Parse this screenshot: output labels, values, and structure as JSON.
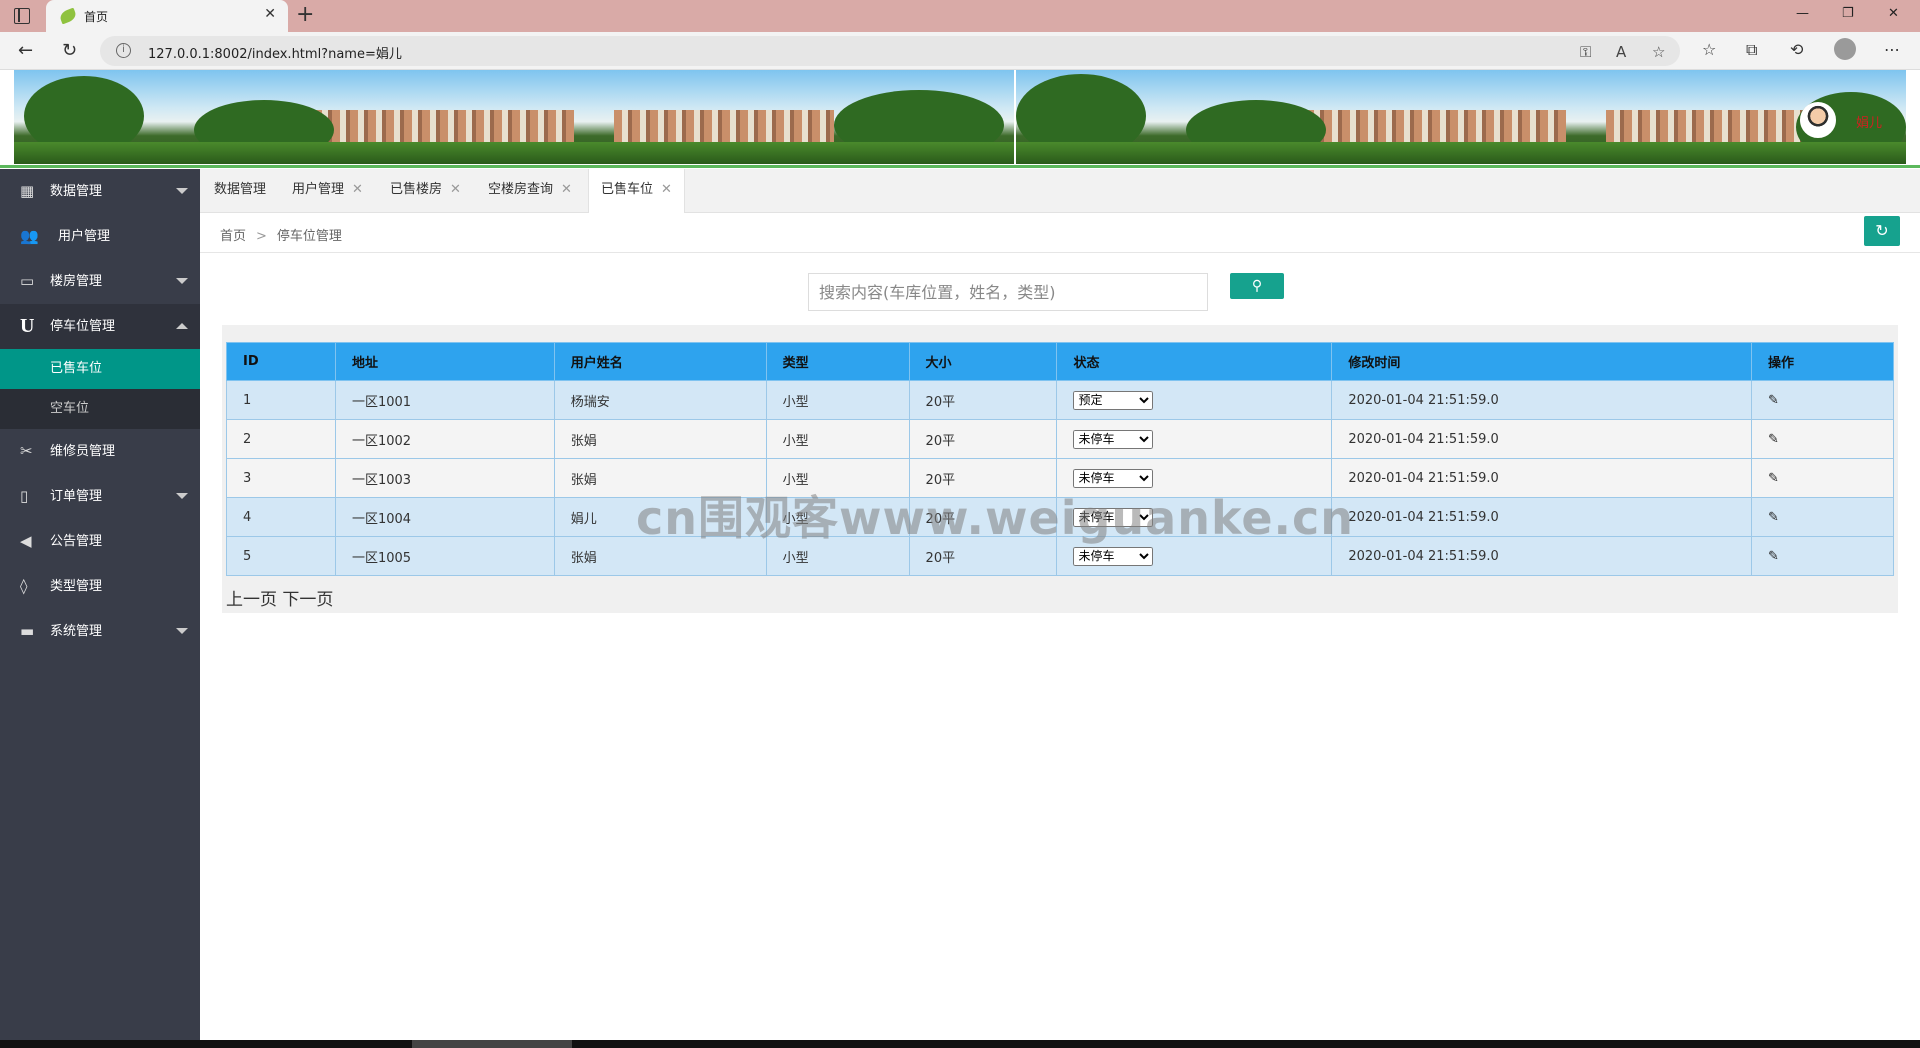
{
  "browser": {
    "tab_title": "首页",
    "tab_close": "✕",
    "new_tab": "+",
    "url": "127.0.0.1:8002/index.html?name=娟儿"
  },
  "header": {
    "user_name": "娟儿"
  },
  "sidebar": {
    "items": [
      {
        "label": "数据管理",
        "icon": "table-icon"
      },
      {
        "label": "用户管理",
        "icon": "users-icon"
      },
      {
        "label": "楼房管理",
        "icon": "window-icon"
      },
      {
        "label": "停车位管理",
        "icon": "u-icon"
      },
      {
        "label": "维修员管理",
        "icon": "tools-icon"
      },
      {
        "label": "订单管理",
        "icon": "document-icon"
      },
      {
        "label": "公告管理",
        "icon": "circle-back-icon"
      },
      {
        "label": "类型管理",
        "icon": "drops-icon"
      },
      {
        "label": "系统管理",
        "icon": "briefcase-icon"
      }
    ],
    "sub_items": [
      "已售车位",
      "空车位"
    ]
  },
  "tabs": [
    {
      "label": "数据管理"
    },
    {
      "label": "用户管理"
    },
    {
      "label": "已售楼房"
    },
    {
      "label": "空楼房查询"
    },
    {
      "label": "已售车位"
    }
  ],
  "breadcrumb": {
    "home": "首页",
    "separator": ">",
    "current": "停车位管理"
  },
  "search": {
    "placeholder": "搜索内容(车库位置，姓名，类型)"
  },
  "table": {
    "headers": [
      "ID",
      "地址",
      "用户姓名",
      "类型",
      "大小",
      "状态",
      "修改时间",
      "操作"
    ],
    "rows": [
      {
        "id": "1",
        "address": "一区1001",
        "user": "杨瑞安",
        "type": "小型",
        "size": "20平",
        "status": "预定",
        "time": "2020-01-04 21:51:59.0"
      },
      {
        "id": "2",
        "address": "一区1002",
        "user": "张娟",
        "type": "小型",
        "size": "20平",
        "status": "未停车",
        "time": "2020-01-04 21:51:59.0"
      },
      {
        "id": "3",
        "address": "一区1003",
        "user": "张娟",
        "type": "小型",
        "size": "20平",
        "status": "未停车",
        "time": "2020-01-04 21:51:59.0"
      },
      {
        "id": "4",
        "address": "一区1004",
        "user": "娟儿",
        "type": "小型",
        "size": "20平",
        "status": "未停车",
        "time": "2020-01-04 21:51:59.0"
      },
      {
        "id": "5",
        "address": "一区1005",
        "user": "张娟",
        "type": "小型",
        "size": "20平",
        "status": "未停车",
        "time": "2020-01-04 21:51:59.0"
      }
    ]
  },
  "pager": {
    "prev": "上一页",
    "next": "下一页"
  },
  "watermark": "cn围观客www.weiguanke.cn",
  "colors": {
    "accent": "#009688",
    "table_header": "#2ea3ee",
    "sidebar": "#393d49"
  }
}
